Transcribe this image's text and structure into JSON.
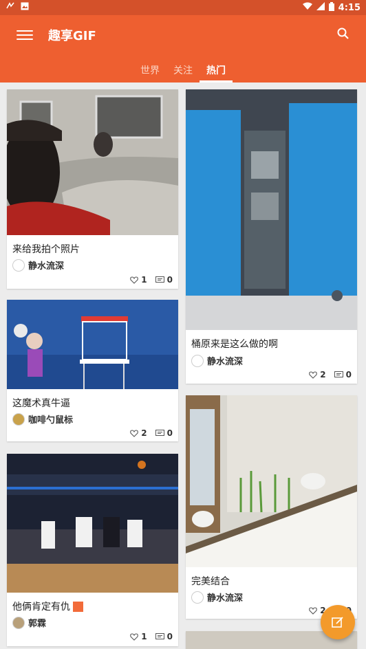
{
  "status_bar": {
    "time": "4:15"
  },
  "app": {
    "title": "趣享GIF"
  },
  "tabs": [
    {
      "label": "世界",
      "active": false
    },
    {
      "label": "关注",
      "active": false
    },
    {
      "label": "热门",
      "active": true
    }
  ],
  "colors": {
    "primary": "#ee5f30",
    "status_bar": "#d4512a",
    "fab": "#f39a2b"
  },
  "feed_left": [
    {
      "title": "来给我拍个照片",
      "author": "静水流深",
      "likes": "1",
      "comments": "0"
    },
    {
      "title": "这魔术真牛逼",
      "author": "咖啡勺鼠标",
      "likes": "2",
      "comments": "0"
    },
    {
      "title": "他俩肯定有仇",
      "author": "郭霖",
      "likes": "1",
      "comments": "0"
    }
  ],
  "feed_right": [
    {
      "title": "桶原来是这么做的啊",
      "author": "静水流深",
      "likes": "2",
      "comments": "0"
    },
    {
      "title": "完美结合",
      "author": "静水流深",
      "likes": "2",
      "comments": "0"
    }
  ],
  "icons": {
    "menu": "hamburger-icon",
    "search": "search-icon",
    "like": "heart-icon",
    "comment": "comment-icon",
    "fab": "edit-icon"
  }
}
